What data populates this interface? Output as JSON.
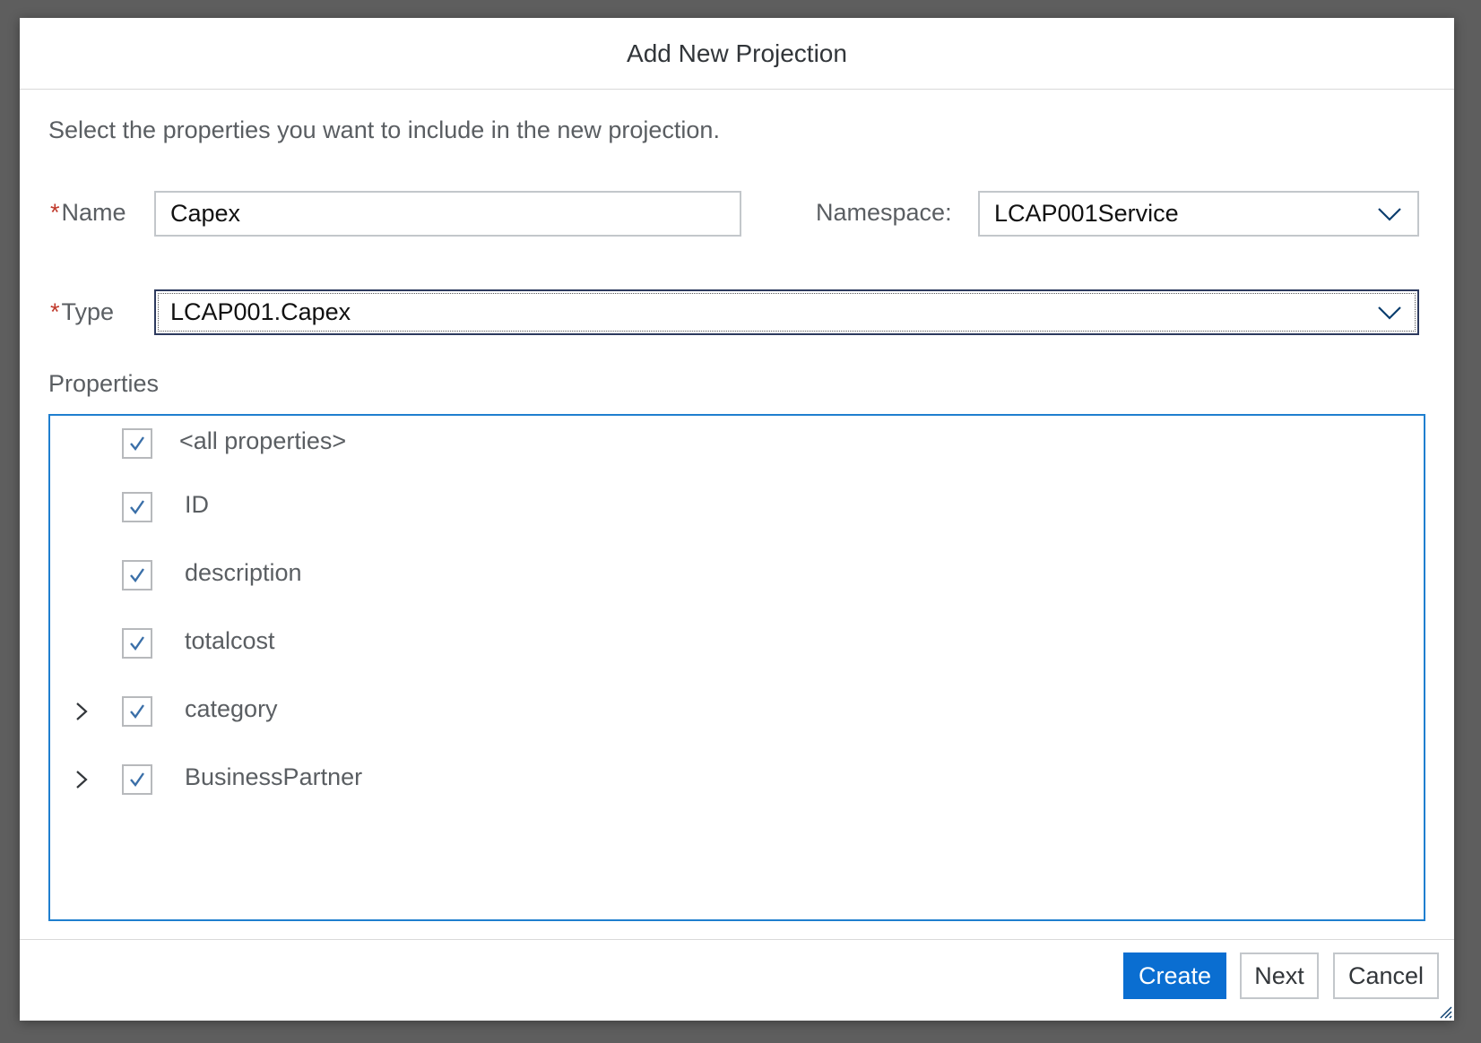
{
  "dialog": {
    "title": "Add New Projection",
    "instructions": "Select the properties you want to include in the new projection."
  },
  "form": {
    "name": {
      "required_mark": "*",
      "label": "Name",
      "value": "Capex"
    },
    "namespace": {
      "label": "Namespace:",
      "value": "LCAP001Service"
    },
    "type": {
      "required_mark": "*",
      "label": "Type",
      "value": "LCAP001.Capex"
    }
  },
  "properties": {
    "label": "Properties",
    "items": [
      {
        "label": "<all properties>",
        "checked": true,
        "expandable": false
      },
      {
        "label": "ID",
        "checked": true,
        "expandable": false
      },
      {
        "label": "description",
        "checked": true,
        "expandable": false
      },
      {
        "label": "totalcost",
        "checked": true,
        "expandable": false
      },
      {
        "label": "category",
        "checked": true,
        "expandable": true
      },
      {
        "label": "BusinessPartner",
        "checked": true,
        "expandable": true
      }
    ]
  },
  "footer": {
    "create_label": "Create",
    "next_label": "Next",
    "cancel_label": "Cancel"
  },
  "colors": {
    "accent": "#0a6ed1",
    "required": "#c0392b",
    "tree_border": "#1f7fcf",
    "overlay": "#5e5e5e"
  },
  "icons": {
    "checkbox": "check-icon",
    "expander": "chevron-right-icon",
    "select": "chevron-down-icon",
    "resize": "resize-grip-icon"
  }
}
